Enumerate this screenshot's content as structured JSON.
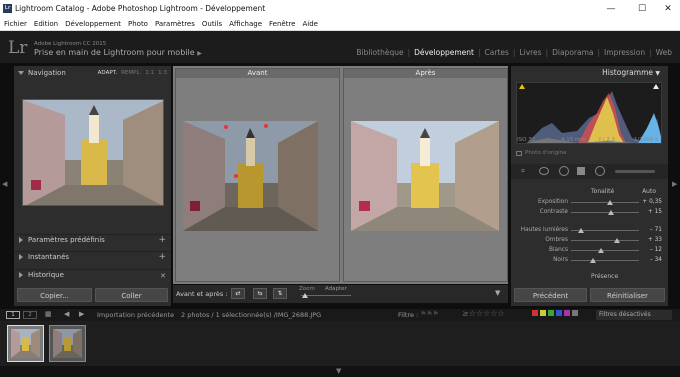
{
  "window": {
    "title": "Lightroom Catalog - Adobe Photoshop Lightroom - Développement",
    "minimize": "—",
    "maximize": "☐",
    "close": "✕"
  },
  "menu": [
    "Fichier",
    "Edition",
    "Développement",
    "Photo",
    "Paramètres",
    "Outils",
    "Affichage",
    "Fenêtre",
    "Aide"
  ],
  "identity": {
    "logo": "Lr",
    "version": "Adobe Lightroom CC 2015",
    "subtitle": "Prise en main de Lightroom pour mobile"
  },
  "modules": [
    {
      "label": "Bibliothèque",
      "active": false
    },
    {
      "label": "Développement",
      "active": true
    },
    {
      "label": "Cartes",
      "active": false
    },
    {
      "label": "Livres",
      "active": false
    },
    {
      "label": "Diaporama",
      "active": false
    },
    {
      "label": "Impression",
      "active": false
    },
    {
      "label": "Web",
      "active": false
    }
  ],
  "left_panel": {
    "navigator": {
      "label": "Navigation",
      "zoom": [
        "ADAPT.",
        "REMPL.",
        "1:1",
        "1:3"
      ],
      "zoom_active": "ADAPT."
    },
    "sections": [
      {
        "label": "Paramètres prédéfinis",
        "action": "+"
      },
      {
        "label": "Instantanés",
        "action": "+"
      },
      {
        "label": "Historique",
        "action": "✕"
      }
    ],
    "copy_button": "Copier...",
    "paste_button": "Coller"
  },
  "compare": {
    "before_label": "Avant",
    "after_label": "Après"
  },
  "toolbar": {
    "label": "Avant et après :",
    "zoom_label": "Zoom",
    "zoom_value": "Adapter",
    "icons": [
      "left-right-icon",
      "swap-icon",
      "copy-settings-icon"
    ]
  },
  "right_panel": {
    "histogram_label": "Histogramme",
    "camera_info": {
      "iso": "ISO 32",
      "focal": "4,15 mm",
      "aperture": "f / 2,2",
      "shutter": "1/1000 s"
    },
    "original_photo_label": "Photo d'origine",
    "tone_label": "Tonalité",
    "tone_auto": "Auto",
    "sliders": [
      {
        "label": "Exposition",
        "value": "+ 0,35",
        "pos": 0.56
      },
      {
        "label": "Contraste",
        "value": "+ 15",
        "pos": 0.58
      },
      {
        "label": "Hautes lumières",
        "value": "– 71",
        "pos": 0.15
      },
      {
        "label": "Ombres",
        "value": "+ 33",
        "pos": 0.67
      },
      {
        "label": "Blancs",
        "value": "– 12",
        "pos": 0.44
      },
      {
        "label": "Noirs",
        "value": "– 34",
        "pos": 0.33
      }
    ],
    "presence_label": "Présence",
    "previous_button": "Précédent",
    "reset_button": "Réinitialiser"
  },
  "filmstrip": {
    "page1": "1",
    "page2": "2",
    "source": "Importation précédente",
    "count": "2 photos / 1 sélectionnée(s) /IMG_2688.JPG",
    "filter_label": "Filtre :",
    "filters_off": "Filtres désactivés"
  }
}
